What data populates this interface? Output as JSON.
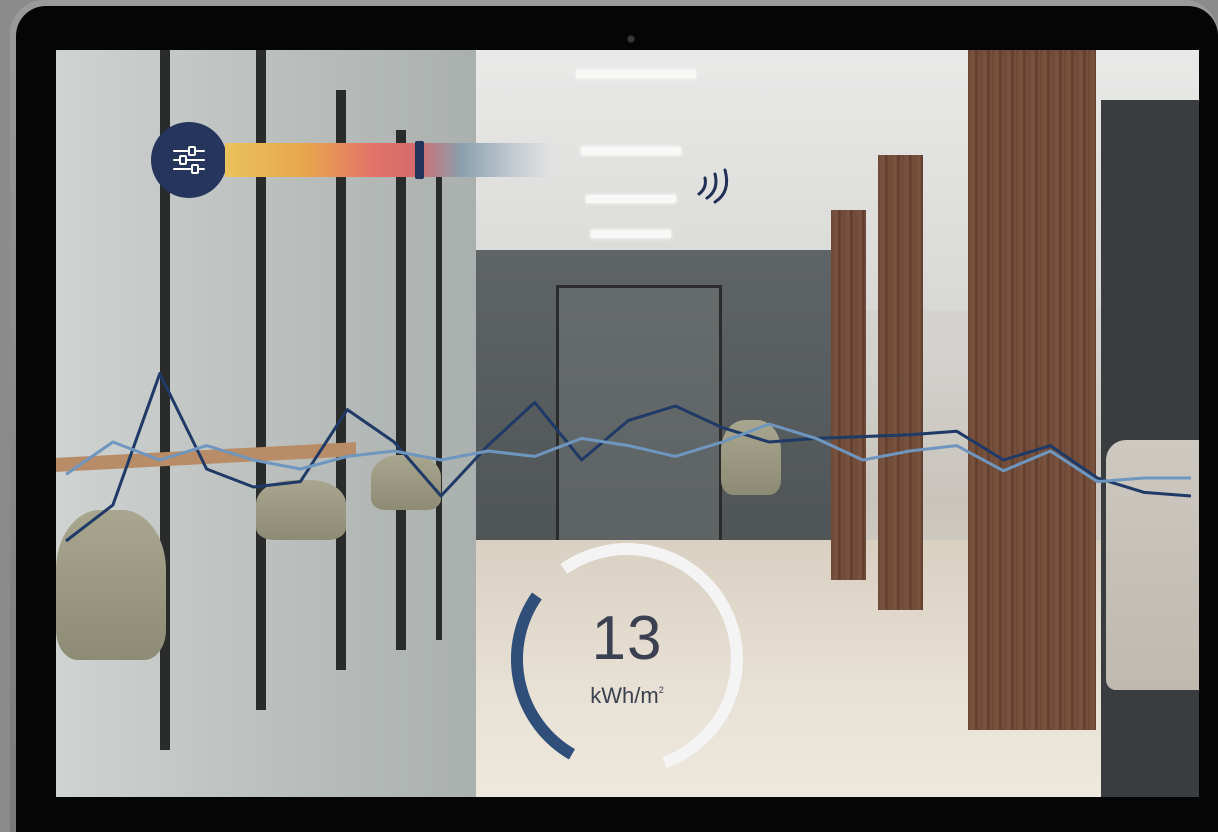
{
  "controls": {
    "settings_icon": "sliders-icon",
    "slider_value_fraction": 0.59,
    "signal_icon": "wireless-signal-icon"
  },
  "gauge": {
    "value": "13",
    "unit": "kWh/m",
    "unit_superscript": "2",
    "fill_fraction": 0.17,
    "accent_color": "#2f4f7a",
    "track_color": "#f4f4f4"
  },
  "chart_data": {
    "type": "line",
    "title": "",
    "xlabel": "",
    "ylabel": "",
    "grid": false,
    "x": [
      0,
      1,
      2,
      3,
      4,
      5,
      6,
      7,
      8,
      9,
      10,
      11,
      12,
      13,
      14,
      15,
      16,
      17,
      18,
      19,
      20,
      21,
      22,
      23,
      24
    ],
    "series": [
      {
        "color": "#1f3a66",
        "values": [
          0.05,
          0.25,
          0.98,
          0.45,
          0.35,
          0.38,
          0.78,
          0.6,
          0.3,
          0.58,
          0.82,
          0.5,
          0.72,
          0.8,
          0.68,
          0.6,
          0.62,
          0.63,
          0.64,
          0.66,
          0.5,
          0.58,
          0.4,
          0.32,
          0.3
        ]
      },
      {
        "color": "#6f96bf",
        "values": [
          0.42,
          0.6,
          0.5,
          0.58,
          0.5,
          0.45,
          0.52,
          0.55,
          0.5,
          0.55,
          0.52,
          0.62,
          0.58,
          0.52,
          0.6,
          0.7,
          0.62,
          0.5,
          0.55,
          0.58,
          0.44,
          0.55,
          0.38,
          0.4,
          0.4
        ]
      }
    ]
  }
}
